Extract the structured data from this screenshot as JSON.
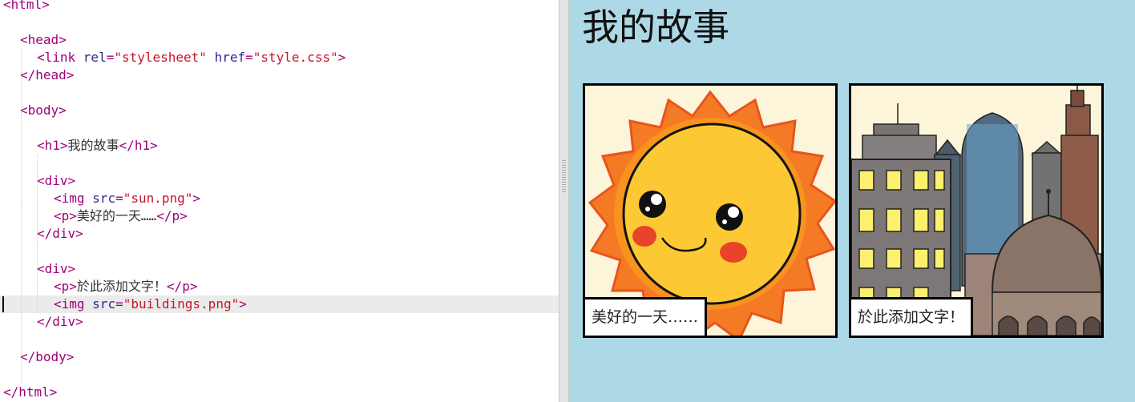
{
  "editor": {
    "lines": [
      [
        {
          "t": "tag",
          "v": "<html>"
        }
      ],
      [],
      [
        {
          "t": "tag",
          "v": "<head>"
        }
      ],
      [
        {
          "t": "tag",
          "v": "<link "
        },
        {
          "t": "attr",
          "v": "rel"
        },
        {
          "t": "tag",
          "v": "="
        },
        {
          "t": "val",
          "v": "\"stylesheet\""
        },
        {
          "t": "tag",
          "v": " "
        },
        {
          "t": "attr",
          "v": "href"
        },
        {
          "t": "tag",
          "v": "="
        },
        {
          "t": "val",
          "v": "\"style.css\""
        },
        {
          "t": "tag",
          "v": ">"
        }
      ],
      [
        {
          "t": "tag",
          "v": "</head>"
        }
      ],
      [],
      [
        {
          "t": "tag",
          "v": "<body>"
        }
      ],
      [],
      [
        {
          "t": "tag",
          "v": "<h1>"
        },
        {
          "t": "txt",
          "v": "我的故事"
        },
        {
          "t": "tag",
          "v": "</h1>"
        }
      ],
      [],
      [
        {
          "t": "tag",
          "v": "<div>"
        }
      ],
      [
        {
          "t": "tag",
          "v": "<img "
        },
        {
          "t": "attr",
          "v": "src"
        },
        {
          "t": "tag",
          "v": "="
        },
        {
          "t": "val",
          "v": "\"sun.png\""
        },
        {
          "t": "tag",
          "v": ">"
        }
      ],
      [
        {
          "t": "tag",
          "v": "<p>"
        },
        {
          "t": "txt",
          "v": "美好的一天……"
        },
        {
          "t": "tag",
          "v": "</p>"
        }
      ],
      [
        {
          "t": "tag",
          "v": "</div>"
        }
      ],
      [],
      [
        {
          "t": "tag",
          "v": "<div>"
        }
      ],
      [
        {
          "t": "tag",
          "v": "<p>"
        },
        {
          "t": "txt",
          "v": "於此添加文字！"
        },
        {
          "t": "tag",
          "v": "</p>"
        }
      ],
      [
        {
          "t": "tag",
          "v": "<img "
        },
        {
          "t": "attr",
          "v": "src"
        },
        {
          "t": "tag",
          "v": "="
        },
        {
          "t": "val",
          "v": "\"buildings.png\""
        },
        {
          "t": "tag",
          "v": ">"
        }
      ],
      [
        {
          "t": "tag",
          "v": "</div>"
        }
      ],
      [],
      [
        {
          "t": "tag",
          "v": "</body>"
        }
      ],
      [],
      [
        {
          "t": "tag",
          "v": "</html>"
        }
      ]
    ],
    "indents": [
      0,
      0,
      1,
      2,
      1,
      0,
      1,
      0,
      2,
      0,
      2,
      3,
      3,
      2,
      0,
      2,
      3,
      3,
      2,
      0,
      1,
      0,
      0
    ],
    "current_line": 17
  },
  "preview": {
    "title": "我的故事",
    "panels": [
      {
        "image": "sun-illustration",
        "caption": "美好的一天……"
      },
      {
        "image": "buildings-illustration",
        "caption": "於此添加文字！"
      }
    ]
  },
  "colors": {
    "tag": "#a0007a",
    "attribute": "#2b2b8f",
    "value": "#c4162a",
    "preview_background": "#add8e6",
    "panel_background": "#fdf5da"
  }
}
